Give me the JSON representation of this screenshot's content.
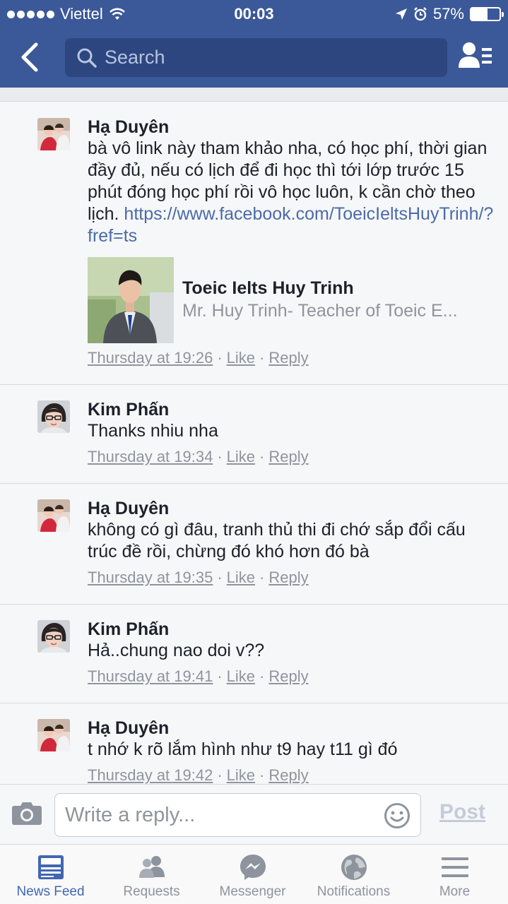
{
  "status_bar": {
    "carrier": "Viettel",
    "time": "00:03",
    "battery": "57%",
    "battery_level": 0.57
  },
  "navbar": {
    "search_placeholder": "Search"
  },
  "comments": [
    {
      "author": "Hạ Duyên",
      "text": "bà vô link này tham khảo nha, có học phí, thời gian đầy đủ, nếu có lịch để đi học thì tới lớp trước 15 phút đóng học phí rồi vô học luôn, k cần chờ theo lịch.",
      "link": "https://www.facebook.com/ToeicIeltsHuyTrinh/?fref=ts",
      "preview": {
        "title": "Toeic Ielts Huy Trinh",
        "subtitle": "Mr. Huy Trinh- Teacher of Toeic E..."
      },
      "time": "Thursday at 19:26",
      "like": "Like",
      "reply": "Reply"
    },
    {
      "author": "Kim Phấn",
      "text": "Thanks nhiu nha",
      "time": "Thursday at 19:34",
      "like": "Like",
      "reply": "Reply"
    },
    {
      "author": "Hạ Duyên",
      "text": "không có gì đâu, tranh thủ thi đi chớ sắp đổi cấu trúc đề rồi, chừng đó khó hơn đó bà",
      "time": "Thursday at 19:35",
      "like": "Like",
      "reply": "Reply"
    },
    {
      "author": "Kim Phấn",
      "text": "Hả..chung nao doi v??",
      "time": "Thursday at 19:41",
      "like": "Like",
      "reply": "Reply"
    },
    {
      "author": "Hạ Duyên",
      "text": "t nhớ k rõ lắm hình như t9 hay t11 gì đó",
      "time": "Thursday at 19:42",
      "like": "Like",
      "reply": "Reply"
    }
  ],
  "reply_bar": {
    "placeholder": "Write a reply...",
    "post_label": "Post"
  },
  "tabs": [
    {
      "label": "News Feed",
      "icon": "news-feed-icon",
      "active": true
    },
    {
      "label": "Requests",
      "icon": "friends-icon",
      "active": false
    },
    {
      "label": "Messenger",
      "icon": "messenger-icon",
      "active": false
    },
    {
      "label": "Notifications",
      "icon": "globe-icon",
      "active": false
    },
    {
      "label": "More",
      "icon": "hamburger-icon",
      "active": false
    }
  ],
  "colors": {
    "brand": "#3b5998",
    "link": "#4b6aa8",
    "active_tab": "#4267b2"
  }
}
